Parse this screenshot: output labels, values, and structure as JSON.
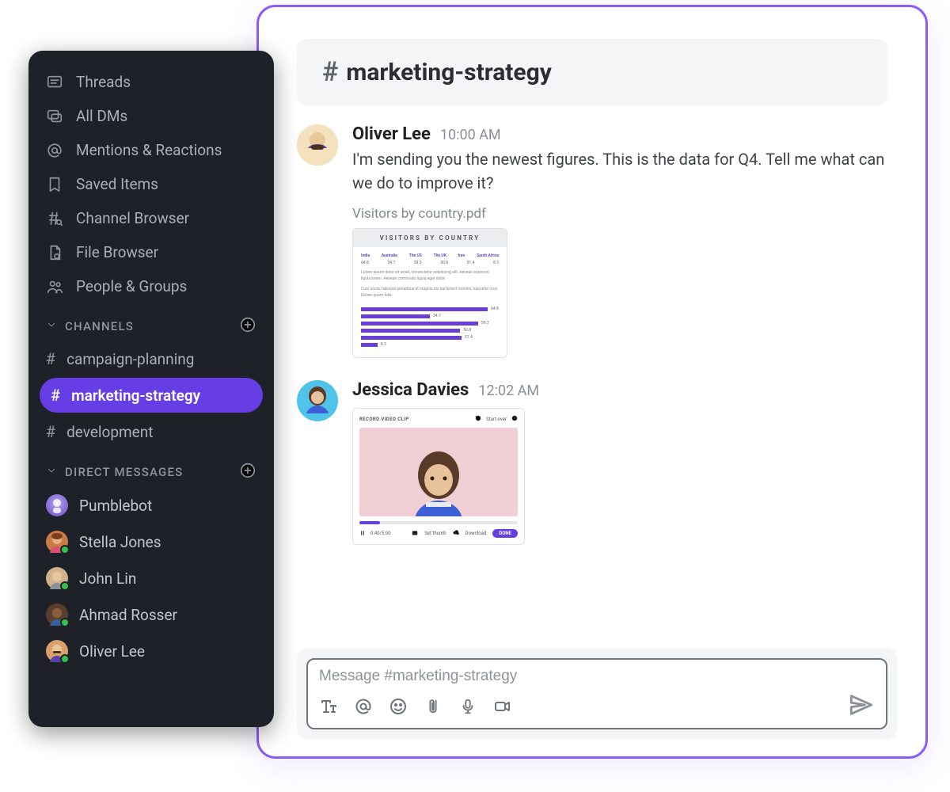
{
  "sidebar": {
    "nav": [
      {
        "label": "Threads",
        "icon": "threads-icon"
      },
      {
        "label": "All DMs",
        "icon": "dms-icon"
      },
      {
        "label": "Mentions & Reactions",
        "icon": "mentions-icon"
      },
      {
        "label": "Saved Items",
        "icon": "bookmark-icon"
      },
      {
        "label": "Channel Browser",
        "icon": "channel-browser-icon"
      },
      {
        "label": "File Browser",
        "icon": "file-browser-icon"
      },
      {
        "label": "People & Groups",
        "icon": "people-icon"
      }
    ],
    "channels_header": "CHANNELS",
    "channels": [
      {
        "name": "campaign-planning",
        "active": false
      },
      {
        "name": "marketing-strategy",
        "active": true
      },
      {
        "name": "development",
        "active": false
      }
    ],
    "dms_header": "DIRECT MESSAGES",
    "dms": [
      {
        "name": "Pumblebot",
        "online": false,
        "color": "#7c6bd0"
      },
      {
        "name": "Stella Jones",
        "online": true,
        "color": "#c97a46"
      },
      {
        "name": "John Lin",
        "online": true,
        "color": "#d2b08a"
      },
      {
        "name": "Ahmad Rosser",
        "online": true,
        "color": "#5a3f2e"
      },
      {
        "name": "Oliver Lee",
        "online": true,
        "color": "#d9a06b"
      }
    ]
  },
  "channel": {
    "name": "marketing-strategy"
  },
  "messages": [
    {
      "author": "Oliver Lee",
      "time": "10:00 AM",
      "text": " I'm sending you the newest figures. This is the data for Q4. Tell me what can we do to improve it?",
      "attachment_label": "Visitors by country.pdf",
      "avatar_bg": "#e8c89a"
    },
    {
      "author": "Jessica Davies",
      "time": "12:02 AM",
      "avatar_bg": "#4fc3e8"
    }
  ],
  "pdf_preview": {
    "title": "VISITORS BY COUNTRY"
  },
  "chart_data": {
    "type": "bar",
    "orientation": "horizontal",
    "title": "VISITORS BY COUNTRY",
    "categories": [
      "India",
      "Australia",
      "The US",
      "The UK",
      "Iran",
      "South Africa"
    ],
    "values": [
      64.8,
      34.7,
      59.3,
      50.8,
      51.4,
      8.3
    ],
    "xlabel": "",
    "ylabel": "",
    "xlim": [
      0,
      70
    ]
  },
  "video_card": {
    "title": "RECORD VIDEO CLIP",
    "start_over": "Start over",
    "time": "0:40/5:00",
    "set_thumb": "Set thumb",
    "download": "Download",
    "done": "DONE",
    "progress_pct": 13
  },
  "composer": {
    "placeholder": "Message #marketing-strategy"
  }
}
